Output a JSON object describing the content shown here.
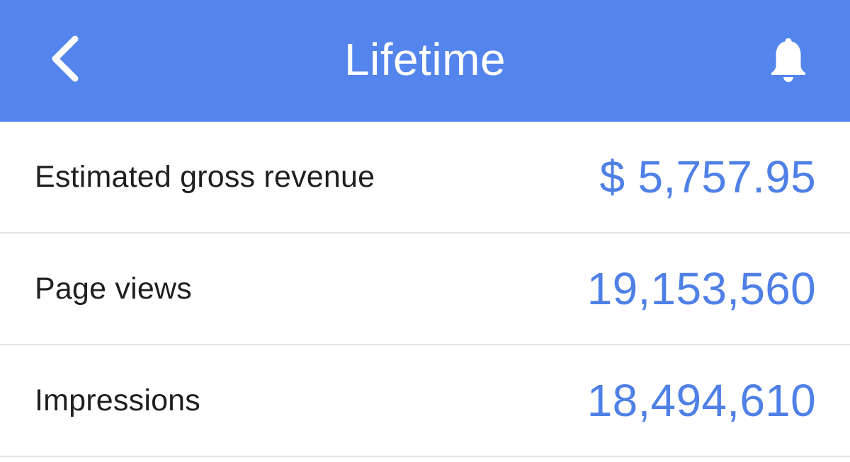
{
  "header": {
    "title": "Lifetime",
    "back_icon": "chevron-left-icon",
    "bell_icon": "bell-icon",
    "background_color": "#5385EC"
  },
  "metrics": [
    {
      "label": "Estimated gross revenue",
      "value": "$ 5,757.95"
    },
    {
      "label": "Page views",
      "value": "19,153,560"
    },
    {
      "label": "Impressions",
      "value": "18,494,610"
    }
  ],
  "colors": {
    "accent": "#4F80E6",
    "label_text": "#1f1f1f",
    "divider": "#e3e3e6"
  }
}
